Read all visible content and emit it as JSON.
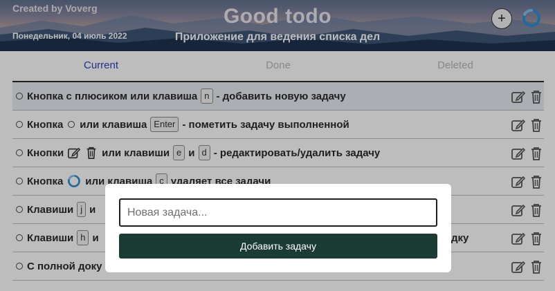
{
  "header": {
    "credit": "Created by Voverg",
    "title": "Good todo",
    "date": "Понедельник, 04 июль 2022",
    "subtitle": "Приложение для ведения списка дел",
    "add_symbol": "+",
    "add_icon": "plus-icon",
    "refresh_icon": "refresh-icon"
  },
  "tabs": [
    {
      "label": "Current",
      "active": true
    },
    {
      "label": "Done",
      "active": false
    },
    {
      "label": "Deleted",
      "active": false
    }
  ],
  "tasks": [
    {
      "parts": [
        "Кнопка с плюсиком или клавиша",
        "n",
        "- добавить новую задачу"
      ]
    },
    {
      "parts": [
        "Кнопка",
        "или клавиша",
        "Enter",
        "- пометить задачу выполненной"
      ]
    },
    {
      "parts": [
        "Кнопки",
        "или клавиши",
        "e",
        "и",
        "d",
        "- редактировать/удалить задачу"
      ]
    },
    {
      "parts": [
        "Кнопка",
        "или клавиша",
        "c",
        "удаляет все задачи"
      ]
    },
    {
      "parts": [
        "Клавиши",
        "j",
        "и"
      ]
    },
    {
      "parts": [
        "Клавиши",
        "h",
        "и",
        "дку"
      ]
    },
    {
      "parts": [
        "С полной доку"
      ]
    }
  ],
  "modal": {
    "input_placeholder": "Новая задача...",
    "input_value": "",
    "submit_label": "Добавить задачу"
  },
  "colors": {
    "accent": "#2f3fbf",
    "submit_bg": "#1b3b35",
    "refresh": "#2a8fd6"
  }
}
